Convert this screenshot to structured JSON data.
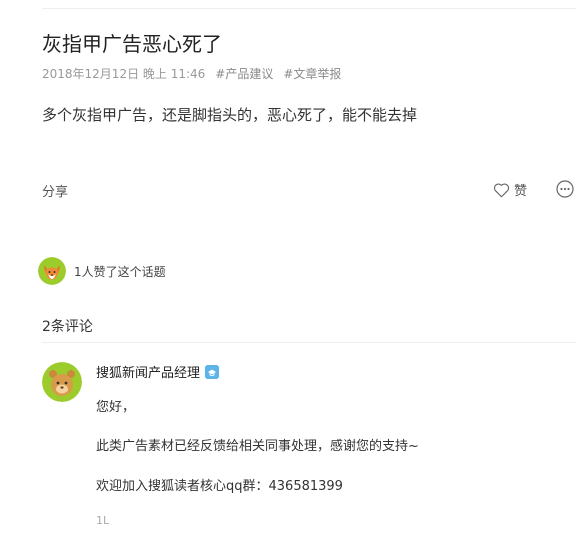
{
  "post": {
    "title": "灰指甲广告恶心死了",
    "timestamp": "2018年12月12日 晚上 11:46",
    "tags": [
      "#产品建议",
      "#文章举报"
    ],
    "body": "多个灰指甲广告，还是脚指头的，恶心死了，能不能去掉"
  },
  "actions": {
    "share_label": "分享",
    "like_label": "赞",
    "like_icon": "heart-outline-icon",
    "more_icon": "more-dots-icon"
  },
  "likes": {
    "summary": "1人赞了这个话题",
    "avatar_icon": "fox-avatar"
  },
  "comments": {
    "count_label": "2条评论",
    "items": [
      {
        "author": "搜狐新闻产品经理",
        "badge_icon": "verified-badge-icon",
        "lines": [
          "您好，",
          "此类广告素材已经反馈给相关同事处理，感谢您的支持~",
          "欢迎加入搜狐读者核心qq群：436581399"
        ],
        "floor": "1L"
      }
    ]
  },
  "colors": {
    "text": "#333333",
    "muted": "#999999",
    "divider": "#eeeeee",
    "avatar_green": "#9ccc2c",
    "badge_blue": "#5bb5e8"
  }
}
